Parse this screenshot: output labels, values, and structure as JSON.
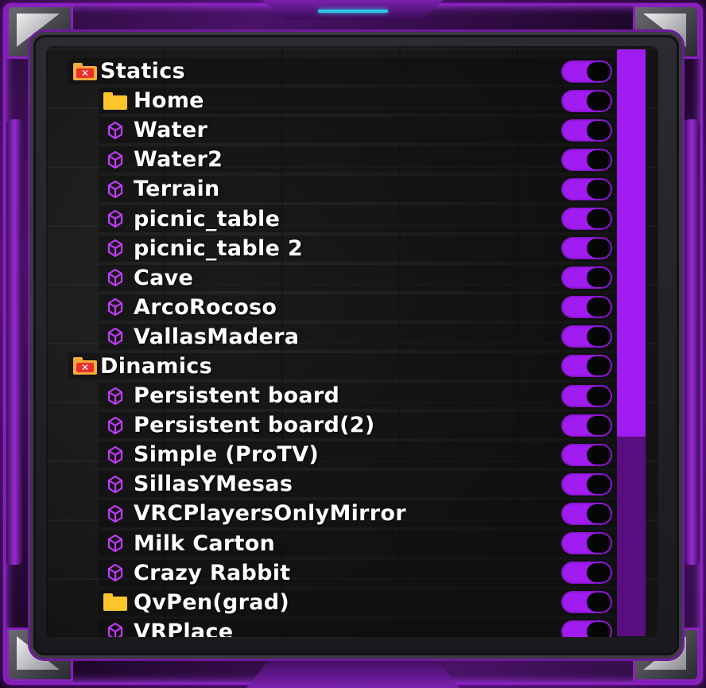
{
  "window": {
    "title": ""
  },
  "colors": {
    "accent": "#a01cf0",
    "frame": "#8a1fc2",
    "toggle_knob": "#050505",
    "folder": "#fcc52c",
    "folder_disabled": "#f7a93b",
    "unity_icon": "#c43cff"
  },
  "hierarchy": {
    "items": [
      {
        "label": "Statics",
        "level": 0,
        "icon": "folder-x-icon",
        "toggle": true
      },
      {
        "label": "Home",
        "level": 1,
        "icon": "folder-icon",
        "toggle": true
      },
      {
        "label": "Water",
        "level": 1,
        "icon": "unity-object-icon",
        "toggle": true
      },
      {
        "label": "Water2",
        "level": 1,
        "icon": "unity-object-icon",
        "toggle": true
      },
      {
        "label": "Terrain",
        "level": 1,
        "icon": "unity-object-icon",
        "toggle": true
      },
      {
        "label": "picnic_table",
        "level": 1,
        "icon": "unity-object-icon",
        "toggle": true
      },
      {
        "label": "picnic_table 2",
        "level": 1,
        "icon": "unity-object-icon",
        "toggle": true
      },
      {
        "label": "Cave",
        "level": 1,
        "icon": "unity-object-icon",
        "toggle": true
      },
      {
        "label": "ArcoRocoso",
        "level": 1,
        "icon": "unity-object-icon",
        "toggle": true
      },
      {
        "label": "VallasMadera",
        "level": 1,
        "icon": "unity-object-icon",
        "toggle": true
      },
      {
        "label": "Dinamics",
        "level": 0,
        "icon": "folder-x-icon",
        "toggle": true
      },
      {
        "label": "Persistent board",
        "level": 1,
        "icon": "unity-object-icon",
        "toggle": true
      },
      {
        "label": "Persistent board(2)",
        "level": 1,
        "icon": "unity-object-icon",
        "toggle": true
      },
      {
        "label": "Simple (ProTV)",
        "level": 1,
        "icon": "unity-object-icon",
        "toggle": true
      },
      {
        "label": "SillasYMesas",
        "level": 1,
        "icon": "unity-object-icon",
        "toggle": true
      },
      {
        "label": "VRCPlayersOnlyMirror",
        "level": 1,
        "icon": "unity-object-icon",
        "toggle": true
      },
      {
        "label": "Milk Carton",
        "level": 1,
        "icon": "unity-object-icon",
        "toggle": true
      },
      {
        "label": "Crazy Rabbit",
        "level": 1,
        "icon": "unity-object-icon",
        "toggle": true
      },
      {
        "label": "QvPen(grad)",
        "level": 1,
        "icon": "folder-icon",
        "toggle": true
      },
      {
        "label": "VRPlace",
        "level": 1,
        "icon": "unity-object-icon",
        "toggle": true
      }
    ]
  },
  "scrollbar": {
    "position": 0,
    "visible_fraction": 0.66
  }
}
